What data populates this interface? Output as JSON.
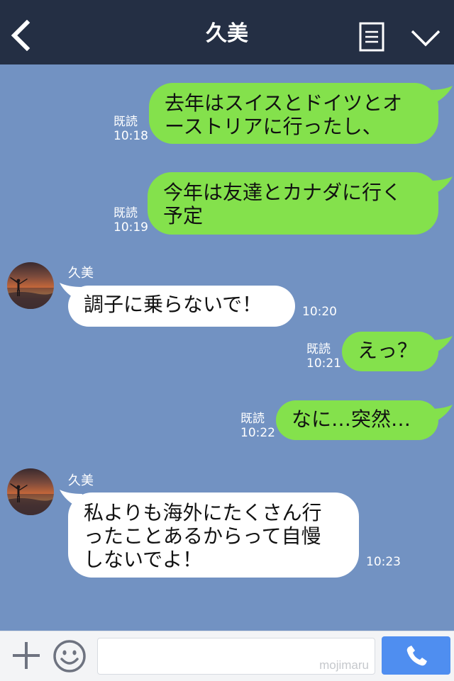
{
  "header": {
    "title": "久美",
    "back_icon": "chevron-left-icon",
    "menu_icon": "menu-icon",
    "collapse_icon": "chevron-down-icon",
    "bg_color": "#242f44"
  },
  "colors": {
    "chat_bg": "#7292c2",
    "sent_bubble": "#84e14c",
    "received_bubble": "#ffffff",
    "call_button": "#4f8ef0"
  },
  "messages": [
    {
      "side": "me",
      "text": "去年はスイスとドイツとオ\nーストリアに行ったし、",
      "read": "既読",
      "time": "10:18"
    },
    {
      "side": "me",
      "text": "今年は友達とカナダに行く\n予定",
      "read": "既読",
      "time": "10:19"
    },
    {
      "side": "them",
      "sender": "久美",
      "text": "調子に乗らないで！",
      "time": "10:20"
    },
    {
      "side": "me",
      "text": "えっ？",
      "read": "既読",
      "time": "10:21"
    },
    {
      "side": "me",
      "text": "なに…突然…",
      "read": "既読",
      "time": "10:22"
    },
    {
      "side": "them",
      "sender": "久美",
      "text": "私よりも海外にたくさん行\nったことあるからって自慢\nしないでよ！",
      "time": "10:23"
    }
  ],
  "footer": {
    "input_placeholder": "mojimaru",
    "plus_icon": "plus-icon",
    "emoji_icon": "smiley-icon",
    "call_icon": "phone-icon"
  }
}
